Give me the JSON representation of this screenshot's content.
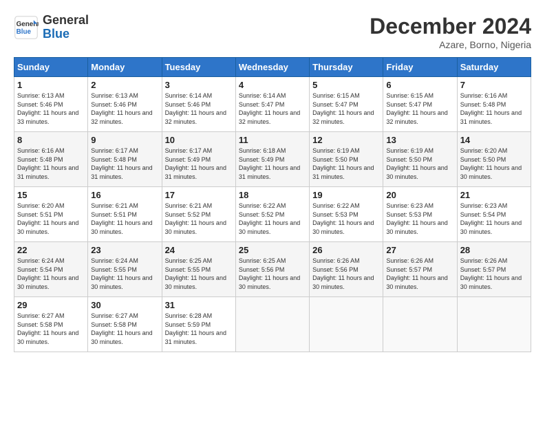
{
  "header": {
    "logo_line1": "General",
    "logo_line2": "Blue",
    "month_title": "December 2024",
    "location": "Azare, Borno, Nigeria"
  },
  "days_of_week": [
    "Sunday",
    "Monday",
    "Tuesday",
    "Wednesday",
    "Thursday",
    "Friday",
    "Saturday"
  ],
  "weeks": [
    [
      {
        "day": 1,
        "sunrise": "6:13 AM",
        "sunset": "5:46 PM",
        "daylight": "11 hours and 33 minutes."
      },
      {
        "day": 2,
        "sunrise": "6:13 AM",
        "sunset": "5:46 PM",
        "daylight": "11 hours and 32 minutes."
      },
      {
        "day": 3,
        "sunrise": "6:14 AM",
        "sunset": "5:46 PM",
        "daylight": "11 hours and 32 minutes."
      },
      {
        "day": 4,
        "sunrise": "6:14 AM",
        "sunset": "5:47 PM",
        "daylight": "11 hours and 32 minutes."
      },
      {
        "day": 5,
        "sunrise": "6:15 AM",
        "sunset": "5:47 PM",
        "daylight": "11 hours and 32 minutes."
      },
      {
        "day": 6,
        "sunrise": "6:15 AM",
        "sunset": "5:47 PM",
        "daylight": "11 hours and 32 minutes."
      },
      {
        "day": 7,
        "sunrise": "6:16 AM",
        "sunset": "5:48 PM",
        "daylight": "11 hours and 31 minutes."
      }
    ],
    [
      {
        "day": 8,
        "sunrise": "6:16 AM",
        "sunset": "5:48 PM",
        "daylight": "11 hours and 31 minutes."
      },
      {
        "day": 9,
        "sunrise": "6:17 AM",
        "sunset": "5:48 PM",
        "daylight": "11 hours and 31 minutes."
      },
      {
        "day": 10,
        "sunrise": "6:17 AM",
        "sunset": "5:49 PM",
        "daylight": "11 hours and 31 minutes."
      },
      {
        "day": 11,
        "sunrise": "6:18 AM",
        "sunset": "5:49 PM",
        "daylight": "11 hours and 31 minutes."
      },
      {
        "day": 12,
        "sunrise": "6:19 AM",
        "sunset": "5:50 PM",
        "daylight": "11 hours and 31 minutes."
      },
      {
        "day": 13,
        "sunrise": "6:19 AM",
        "sunset": "5:50 PM",
        "daylight": "11 hours and 30 minutes."
      },
      {
        "day": 14,
        "sunrise": "6:20 AM",
        "sunset": "5:50 PM",
        "daylight": "11 hours and 30 minutes."
      }
    ],
    [
      {
        "day": 15,
        "sunrise": "6:20 AM",
        "sunset": "5:51 PM",
        "daylight": "11 hours and 30 minutes."
      },
      {
        "day": 16,
        "sunrise": "6:21 AM",
        "sunset": "5:51 PM",
        "daylight": "11 hours and 30 minutes."
      },
      {
        "day": 17,
        "sunrise": "6:21 AM",
        "sunset": "5:52 PM",
        "daylight": "11 hours and 30 minutes."
      },
      {
        "day": 18,
        "sunrise": "6:22 AM",
        "sunset": "5:52 PM",
        "daylight": "11 hours and 30 minutes."
      },
      {
        "day": 19,
        "sunrise": "6:22 AM",
        "sunset": "5:53 PM",
        "daylight": "11 hours and 30 minutes."
      },
      {
        "day": 20,
        "sunrise": "6:23 AM",
        "sunset": "5:53 PM",
        "daylight": "11 hours and 30 minutes."
      },
      {
        "day": 21,
        "sunrise": "6:23 AM",
        "sunset": "5:54 PM",
        "daylight": "11 hours and 30 minutes."
      }
    ],
    [
      {
        "day": 22,
        "sunrise": "6:24 AM",
        "sunset": "5:54 PM",
        "daylight": "11 hours and 30 minutes."
      },
      {
        "day": 23,
        "sunrise": "6:24 AM",
        "sunset": "5:55 PM",
        "daylight": "11 hours and 30 minutes."
      },
      {
        "day": 24,
        "sunrise": "6:25 AM",
        "sunset": "5:55 PM",
        "daylight": "11 hours and 30 minutes."
      },
      {
        "day": 25,
        "sunrise": "6:25 AM",
        "sunset": "5:56 PM",
        "daylight": "11 hours and 30 minutes."
      },
      {
        "day": 26,
        "sunrise": "6:26 AM",
        "sunset": "5:56 PM",
        "daylight": "11 hours and 30 minutes."
      },
      {
        "day": 27,
        "sunrise": "6:26 AM",
        "sunset": "5:57 PM",
        "daylight": "11 hours and 30 minutes."
      },
      {
        "day": 28,
        "sunrise": "6:26 AM",
        "sunset": "5:57 PM",
        "daylight": "11 hours and 30 minutes."
      }
    ],
    [
      {
        "day": 29,
        "sunrise": "6:27 AM",
        "sunset": "5:58 PM",
        "daylight": "11 hours and 30 minutes."
      },
      {
        "day": 30,
        "sunrise": "6:27 AM",
        "sunset": "5:58 PM",
        "daylight": "11 hours and 30 minutes."
      },
      {
        "day": 31,
        "sunrise": "6:28 AM",
        "sunset": "5:59 PM",
        "daylight": "11 hours and 31 minutes."
      },
      null,
      null,
      null,
      null
    ]
  ]
}
